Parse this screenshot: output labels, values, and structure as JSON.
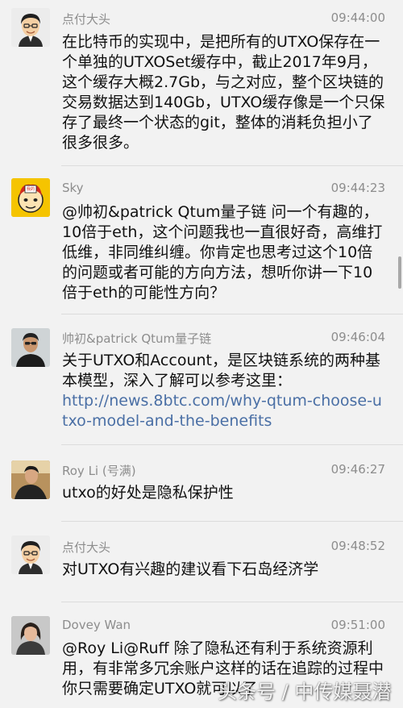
{
  "messages": [
    {
      "name": "点付大头",
      "time": "09:44:00",
      "avatar": "cartoon-man-avatar",
      "text": "在比特币的实现中，是把所有的UTXO保存在一个单独的UTXOSet缓存中，截止2017年9月，这个缓存大概2.7Gb，与之对应，整个区块链的交易数据达到140Gb，UTXO缓存像是一个只保存了最终一个状态的git，整体的消耗负担小了很多很多。"
    },
    {
      "name": "Sky",
      "time": "09:44:23",
      "avatar": "yellow-emoji-avatar",
      "avatar_text": "我的\n我就是我",
      "text": "@帅初&patrick Qtum量子链 问一个有趣的，10倍于eth，这个问题我也一直很好奇，高维打低维，非同维纠缠。你肯定也思考过这个10倍的问题或者可能的方向方法，想听你讲一下10倍于eth的可能性方向？"
    },
    {
      "name": "帅初&patrick Qtum量子链",
      "time": "09:46:04",
      "avatar": "photo-man-avatar",
      "text": "关于UTXO和Account，是区块链系统的两种基本模型，深入了解可以参考这里：",
      "link": "http://news.8btc.com/why-qtum-choose-utxo-model-and-the-benefits"
    },
    {
      "name": "Roy Li (号满)",
      "time": "09:46:27",
      "avatar": "photo-man-avatar",
      "text": "utxo的好处是隐私保护性"
    },
    {
      "name": "点付大头",
      "time": "09:48:52",
      "avatar": "cartoon-man-avatar",
      "text": "对UTXO有兴趣的建议看下石岛经济学"
    },
    {
      "name": "Dovey Wan",
      "time": "09:51:00",
      "avatar": "photo-woman-avatar",
      "text": "@Roy Li@Ruff 除了隐私还有利于系统资源利用，有非常多冗余账户这样的话在追踪的过程中你只需要确定UTXO就可以了"
    }
  ],
  "watermark": "头条号 / 中传媒聂潜"
}
